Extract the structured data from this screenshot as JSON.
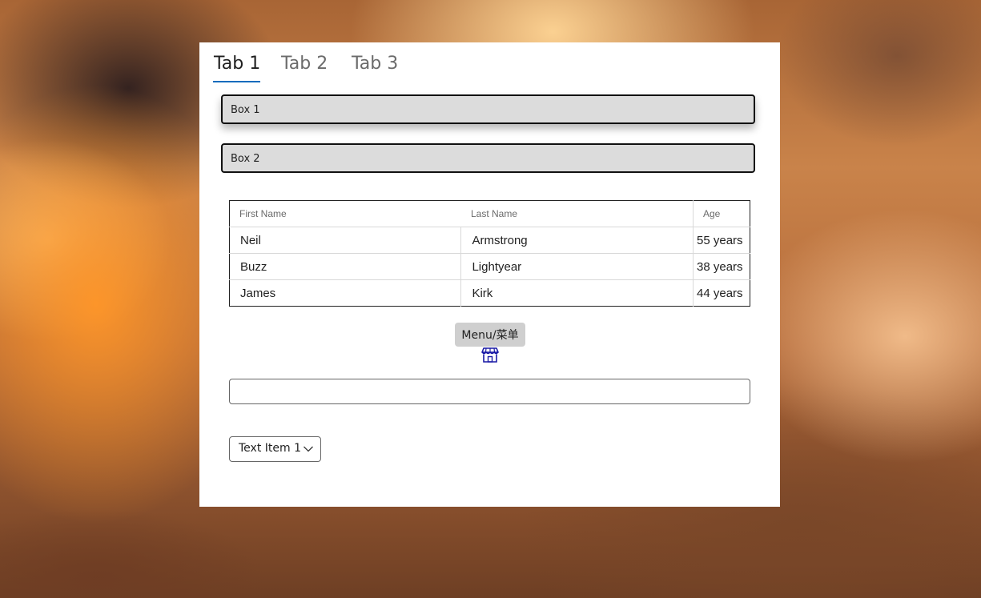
{
  "tabs": [
    {
      "label": "Tab 1",
      "active": true
    },
    {
      "label": "Tab 2",
      "active": false
    },
    {
      "label": "Tab 3",
      "active": false
    }
  ],
  "boxes": {
    "box1": "Box 1",
    "box2": "Box 2"
  },
  "table": {
    "headers": [
      "First Name",
      "Last Name",
      "Age"
    ],
    "rows": [
      [
        "Neil",
        "Armstrong",
        "55 years"
      ],
      [
        "Buzz",
        "Lightyear",
        "38 years"
      ],
      [
        "James",
        "Kirk",
        "44 years"
      ]
    ]
  },
  "menu": {
    "label": "Menu/菜单",
    "icon": "store-icon"
  },
  "text_input": {
    "value": "",
    "placeholder": ""
  },
  "dropdown": {
    "selected": "Text Item 1",
    "icon": "chevron-down-icon"
  },
  "colors": {
    "tab_underline": "#0f6cbd",
    "store_icon": "#1a1aa6",
    "box_background": "#dcdcdc"
  }
}
